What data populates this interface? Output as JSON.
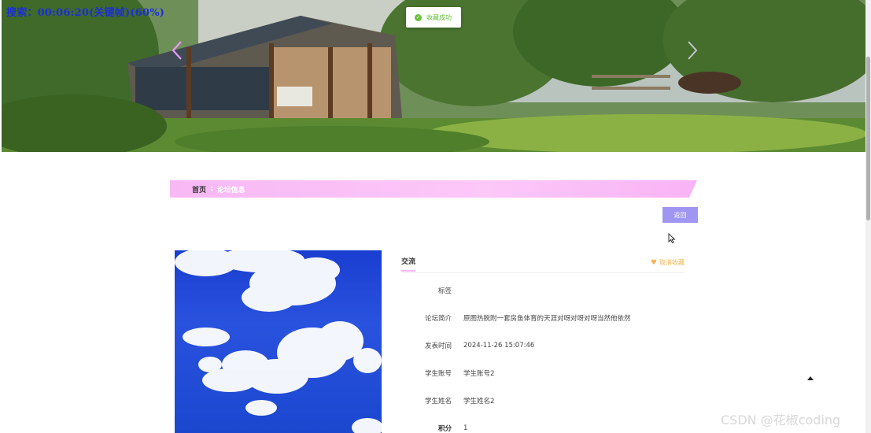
{
  "overlay": {
    "recording_text": "搜索：00:06:20(关键帧)(60%)"
  },
  "toast": {
    "message": "收藏成功"
  },
  "breadcrumb": {
    "home": "首页",
    "separator": ":",
    "current": "论坛信息"
  },
  "actions": {
    "back_label": "返回",
    "favorite_label": "取消收藏"
  },
  "detail": {
    "title": "交流",
    "fields": [
      {
        "label": "标签",
        "value": ""
      },
      {
        "label": "论坛简介",
        "value": "原图热脱附一套房鱼体育的天涯对呀对呀对呀当然他依然"
      },
      {
        "label": "发表时间",
        "value": "2024-11-26 15:07:46"
      },
      {
        "label": "学生账号",
        "value": "学生账号2"
      },
      {
        "label": "学生姓名",
        "value": "学生姓名2"
      },
      {
        "label": "积分",
        "value": "1"
      }
    ]
  },
  "watermark": "CSDN @花椒coding",
  "colors": {
    "accent_pink": "#f8b8f4",
    "button_purple": "#9f96f2",
    "favorite_orange": "#f1b553",
    "toast_green": "#67c23a"
  },
  "icons": [
    "chevron-left-icon",
    "chevron-right-icon",
    "check-circle-icon",
    "heart-icon",
    "arrow-up-icon",
    "mouse-cursor-icon"
  ]
}
